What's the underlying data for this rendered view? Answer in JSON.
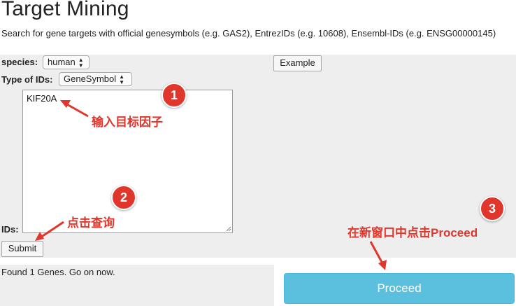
{
  "page": {
    "title": "Target Mining",
    "subtitle": "Search for gene targets with official genesymbols (e.g. GAS2), EntrezIDs (e.g. 10608), Ensembl-IDs (e.g. ENSG00000145)"
  },
  "form": {
    "species_label": "species:",
    "species_value": "human",
    "idtype_label": "Type of IDs:",
    "idtype_value": "GeneSymbol",
    "ids_label": "IDs:",
    "ids_value": "KIF20A",
    "example_label": "Example",
    "submit_label": "Submit"
  },
  "result": {
    "status": "Found 1 Genes. Go on now.",
    "proceed_label": "Proceed"
  },
  "annotations": [
    {
      "number": "1",
      "text": "输入目标因子"
    },
    {
      "number": "2",
      "text": "点击查询"
    },
    {
      "number": "3",
      "text": "在新窗口中点击Proceed"
    }
  ],
  "colors": {
    "annotation_red": "#e0362c",
    "proceed_blue": "#5bc0de",
    "panel_gray": "#eeeeee"
  }
}
